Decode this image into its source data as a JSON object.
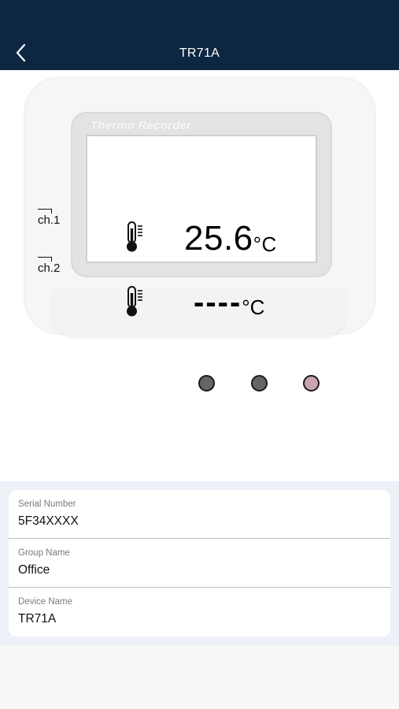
{
  "header": {
    "title": "TR71A",
    "back_icon": "chevron-left-icon"
  },
  "device": {
    "brand": "Thermo Recorder",
    "channels": [
      {
        "label": "ch.1",
        "value": "25.6",
        "unit": "°C"
      },
      {
        "label": "ch.2",
        "value": "----",
        "unit": "°C"
      }
    ],
    "button_colors": [
      "#666666",
      "#666666",
      "#c9a3ae"
    ]
  },
  "info": {
    "rows": [
      {
        "label": "Serial Number",
        "value": "5F34XXXX"
      },
      {
        "label": "Group Name",
        "value": "Office"
      },
      {
        "label": "Device Name",
        "value": "TR71A"
      }
    ]
  },
  "colors": {
    "navbar": "#0d2743",
    "section_bg": "#eef0f7"
  }
}
